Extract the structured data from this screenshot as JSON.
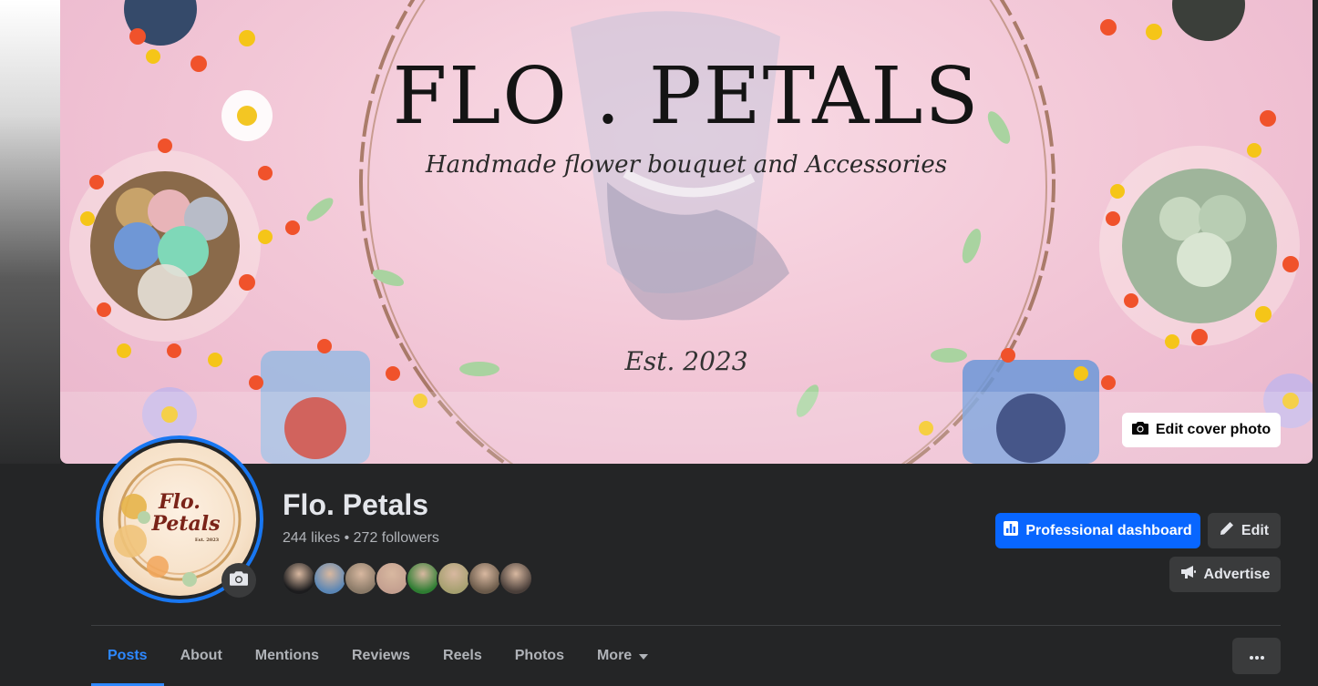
{
  "cover": {
    "title": "FLO . PETALS",
    "subtitle": "Handmade flower bouquet and Accessories",
    "est": "Est. 2023",
    "edit_button_label": "Edit cover photo"
  },
  "profile": {
    "logo_line1": "Flo.",
    "logo_line2": "Petals",
    "logo_small": "Est. 2023"
  },
  "page": {
    "name": "Flo. Petals",
    "stats": "244 likes • 272 followers",
    "follower_avatar_colors": [
      "#1c1c1e",
      "#5a86b5",
      "#8a7a68",
      "#c4a090",
      "#2e7d32",
      "#a6a070",
      "#6a5a4a",
      "#4a3f3a"
    ]
  },
  "actions": {
    "professional_dashboard": "Professional dashboard",
    "edit": "Edit",
    "advertise": "Advertise"
  },
  "tabs": [
    {
      "label": "Posts",
      "active": true
    },
    {
      "label": "About"
    },
    {
      "label": "Mentions"
    },
    {
      "label": "Reviews"
    },
    {
      "label": "Reels"
    },
    {
      "label": "Photos"
    },
    {
      "label": "More"
    }
  ],
  "colors": {
    "accent": "#0866ff",
    "active_tab": "#2d88ff",
    "background": "#242526",
    "secondary_button": "#3a3b3c"
  }
}
